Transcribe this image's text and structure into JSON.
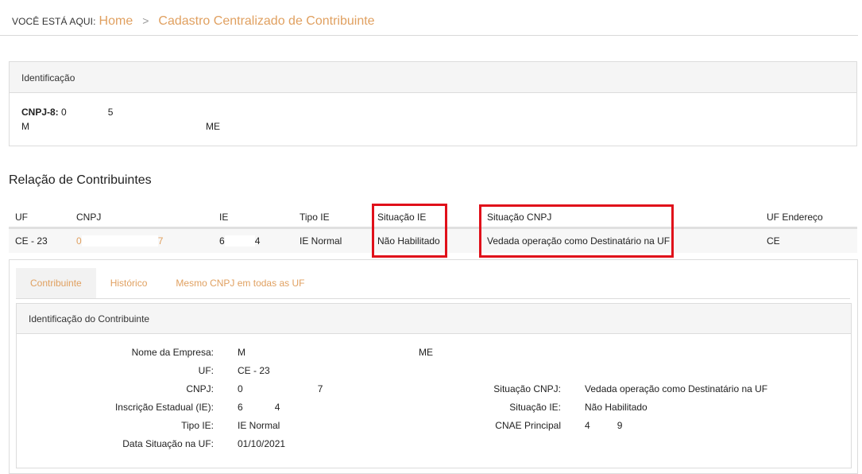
{
  "breadcrumb": {
    "prefix": "VOCÊ ESTÁ AQUI:",
    "home": "Home",
    "separator": ">",
    "current": "Cadastro Centralizado de Contribuinte"
  },
  "identificacao": {
    "title": "Identificação",
    "cnpj_label": "CNPJ-8:",
    "cnpj_value_start": "0",
    "cnpj_value_end": "5",
    "name_start": "M",
    "name_end": "ME"
  },
  "relacao": {
    "title": "Relação de Contribuintes",
    "columns": [
      "UF",
      "CNPJ",
      "IE",
      "Tipo IE",
      "Situação IE",
      "Situação CNPJ",
      "UF Endereço"
    ],
    "row": {
      "uf": "CE - 23",
      "cnpj_start": "0",
      "cnpj_end": "7",
      "ie_start": "6",
      "ie_end": "4",
      "tipo_ie": "IE Normal",
      "situacao_ie": "Não Habilitado",
      "situacao_cnpj": "Vedada operação como Destinatário na UF",
      "uf_endereco": "CE"
    }
  },
  "tabs": [
    "Contribuinte",
    "Histórico",
    "Mesmo CNPJ em todas as UF"
  ],
  "detalhe": {
    "title": "Identificação do Contribuinte",
    "labels": {
      "nome": "Nome da Empresa:",
      "uf": "UF:",
      "cnpj": "CNPJ:",
      "ie": "Inscrição Estadual (IE):",
      "tipo_ie": "Tipo IE:",
      "data_situacao": "Data Situação na UF:",
      "situacao_cnpj": "Situação CNPJ:",
      "situacao_ie": "Situação IE:",
      "cnae": "CNAE Principal"
    },
    "values": {
      "nome_start": "M",
      "nome_end": "ME",
      "uf": "CE - 23",
      "cnpj_start": "0",
      "cnpj_end": "7",
      "ie_start": "6",
      "ie_end": "4",
      "tipo_ie": "IE Normal",
      "data_situacao": "01/10/2021",
      "situacao_cnpj": "Vedada operação como Destinatário na UF",
      "situacao_ie": "Não Habilitado",
      "cnae_start": "4",
      "cnae_end": "9"
    }
  },
  "colors": {
    "accent": "#e0a060",
    "highlight": "#e0101a"
  }
}
